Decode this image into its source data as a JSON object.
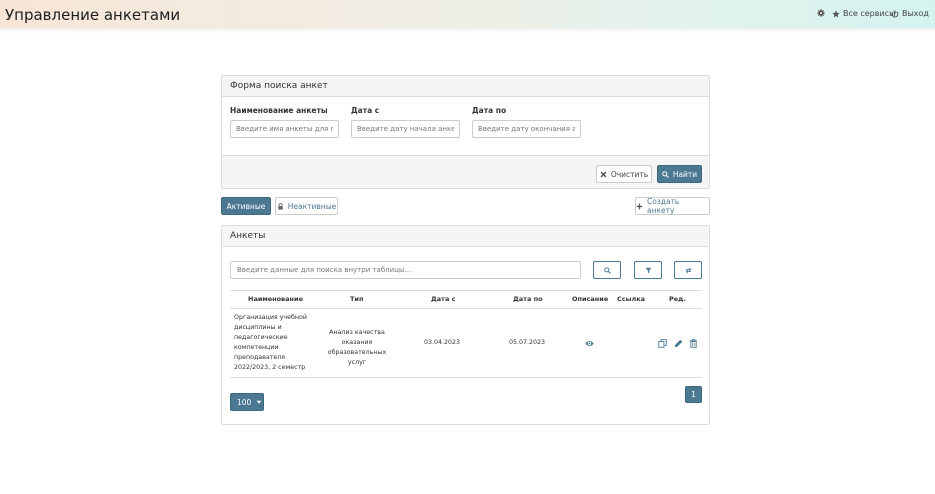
{
  "header": {
    "title": "Управление анкетами",
    "links": [
      {
        "label": "",
        "icon": "gear-icon"
      },
      {
        "label": "Все сервисы",
        "icon": "star-icon"
      },
      {
        "label": "Выход",
        "icon": "power-icon"
      }
    ]
  },
  "search_form": {
    "title": "Форма поиска анкет",
    "fields": [
      {
        "label": "Наименование анкеты",
        "placeholder": "Введите имя анкеты для поиска"
      },
      {
        "label": "Дата с",
        "placeholder": "Введите дату начала анкеты"
      },
      {
        "label": "Дата по",
        "placeholder": "Введите дату окончания анкеты"
      }
    ],
    "clear_label": "Очистить",
    "find_label": "Найти"
  },
  "filters": {
    "active_label": "Активные",
    "inactive_label": "Неактивные",
    "create_label": "Создать анкету"
  },
  "table": {
    "title": "Анкеты",
    "search_placeholder": "Введите данные для поиска внутри таблицы...",
    "columns": [
      "Наименование",
      "Тип",
      "Дата с",
      "Дата по",
      "Описание",
      "Ссылка",
      "Ред."
    ],
    "rows": [
      {
        "name": "Организация учебной дисциплины и педагогические компетенции преподавателя 2022/2023, 2 семестр",
        "type": "Анализ качества оказания образовательных услуг",
        "date_from": "03.04.2023",
        "date_to": "05.07.2023"
      }
    ],
    "page_size": "100",
    "current_page": "1"
  },
  "colors": {
    "primary": "#4c7992",
    "header_gradient_start": "#f7e6d8",
    "header_gradient_end": "#d4f3ef"
  }
}
